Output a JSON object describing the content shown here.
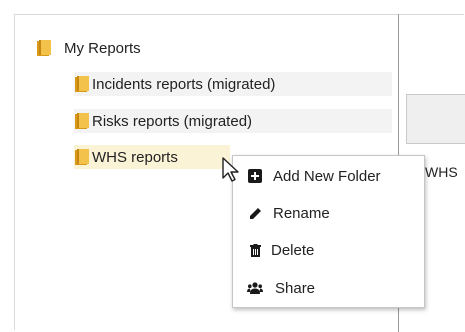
{
  "tree": {
    "root": {
      "label": "My Reports",
      "icon": "folder-icon"
    },
    "children": [
      {
        "label": "Incidents reports (migrated)",
        "icon": "folder-icon"
      },
      {
        "label": "Risks reports (migrated)",
        "icon": "folder-icon"
      },
      {
        "label": "WHS reports",
        "icon": "folder-icon",
        "selected": true
      }
    ]
  },
  "context_menu": {
    "items": [
      {
        "label": "Add New Folder",
        "icon": "plus-square-icon"
      },
      {
        "label": "Rename",
        "icon": "pencil-icon"
      },
      {
        "label": "Delete",
        "icon": "trash-icon"
      },
      {
        "label": "Share",
        "icon": "users-icon"
      }
    ]
  },
  "right_pane": {
    "text": "WHS"
  },
  "colors": {
    "folder": "#e8b02a",
    "selected_row": "#fbf3d6",
    "hover_row": "#f3f3f3"
  }
}
